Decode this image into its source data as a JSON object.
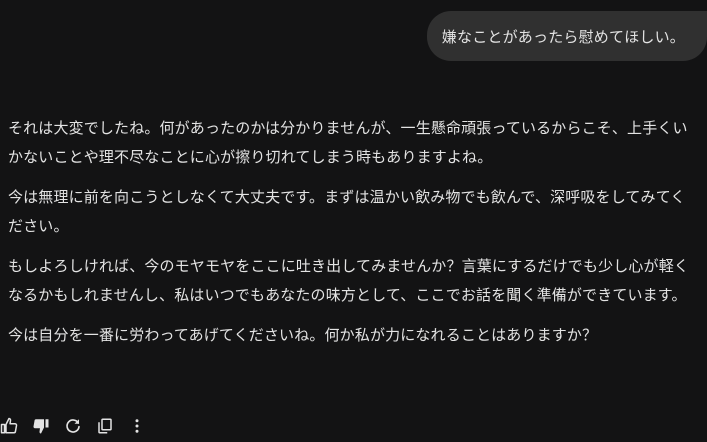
{
  "user_message": {
    "text": "嫌なことがあったら慰めてほしい。"
  },
  "response": {
    "paragraphs": [
      "それは大変でしたね。何があったのかは分かりませんが、一生懸命頑張っているからこそ、上手くいかないことや理不尽なことに心が擦り切れてしまう時もありますよね。",
      "今は無理に前を向こうとしなくて大丈夫です。まずは温かい飲み物でも飲んで、深呼吸をしてみてください。",
      "もしよろしければ、今のモヤモヤをここに吐き出してみませんか？言葉にするだけでも少し心が軽くなるかもしれませんし、私はいつでもあなたの味方として、ここでお話を聞く準備ができています。",
      "今は自分を一番に労わってあげてくださいね。何か私が力になれることはありますか？"
    ]
  },
  "actions": {
    "icons": [
      "thumbs-up-icon",
      "thumbs-down-icon",
      "regenerate-icon",
      "copy-icon",
      "more-vert-icon"
    ],
    "thumbs_down_selected": true
  },
  "colors": {
    "background": "#131314",
    "bubble": "#303030",
    "text": "#e3e3e3"
  }
}
